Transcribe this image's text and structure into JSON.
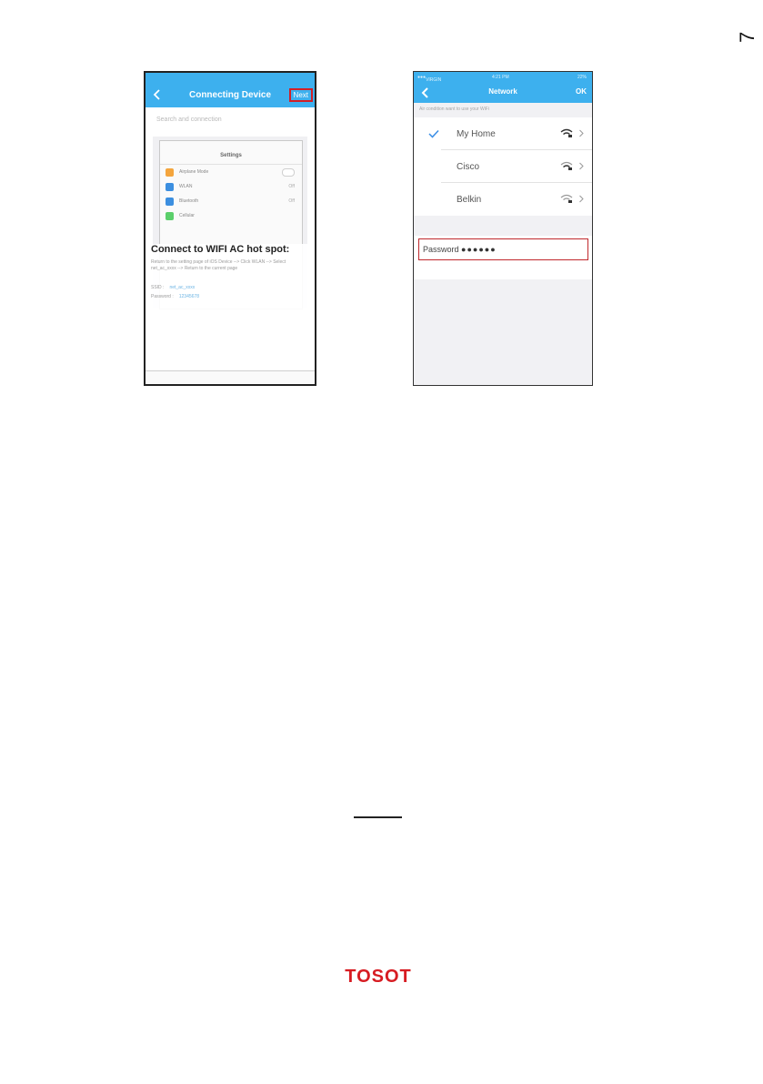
{
  "page_number": "7",
  "phone1": {
    "status": {
      "carrier": "",
      "time": "",
      "battery": ""
    },
    "nav": {
      "title": "Connecting Device",
      "next_label": "Next"
    },
    "search_text": "Search and connection",
    "inner": {
      "title": "Settings",
      "rows": [
        {
          "label": "Airplane Mode",
          "value": "",
          "color": "#f4a53d"
        },
        {
          "label": "WLAN",
          "value": "Off",
          "color": "#3c8fe0"
        },
        {
          "label": "Bluetooth",
          "value": "Off",
          "color": "#3c8fe0"
        },
        {
          "label": "Cellular",
          "value": "",
          "color": "#5bcf6b"
        }
      ]
    },
    "hotspot": {
      "title": "Connect to WIFI AC hot spot:",
      "description": "Return to the setting page of iOS Device --> Click WLAN --> Select net_ac_xxxx --> Return to the current page",
      "ssid_label": "SSID :",
      "ssid_value": "net_ac_xxxx",
      "password_label": "Password :",
      "password_value": "12345678"
    }
  },
  "phone2": {
    "status": {
      "carrier": "VIRGIN",
      "time": "4:21 PM",
      "battery": "22%"
    },
    "nav": {
      "title": "Network",
      "ok_label": "OK"
    },
    "hint": "Air condition want to use your WiFi",
    "networks": [
      {
        "name": "My Home",
        "selected": true
      },
      {
        "name": "Cisco",
        "selected": false
      },
      {
        "name": "Belkin",
        "selected": false
      }
    ],
    "password": {
      "label": "Password",
      "dots": "●●●●●●"
    }
  },
  "colors": {
    "accent": "#3db0ee",
    "highlight": "#c0282c",
    "logo": "#d71c22"
  },
  "logo_text": "TOSOT"
}
